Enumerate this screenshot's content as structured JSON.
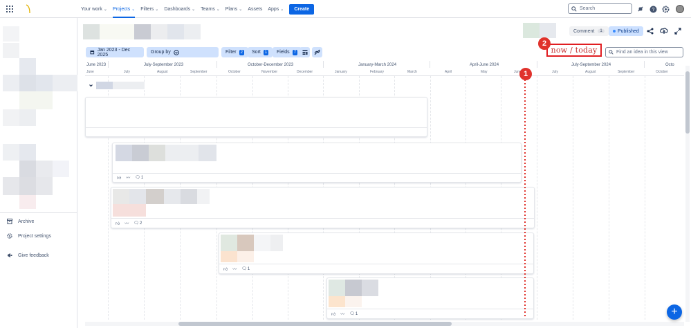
{
  "topnav": {
    "items": [
      {
        "label": "Your work"
      },
      {
        "label": "Projects"
      },
      {
        "label": "Filters"
      },
      {
        "label": "Dashboards"
      },
      {
        "label": "Teams"
      },
      {
        "label": "Plans"
      },
      {
        "label": "Assets"
      },
      {
        "label": "Apps"
      }
    ],
    "active": "Projects",
    "create_label": "Create",
    "search_placeholder": "Search",
    "icons": [
      "apps-grid-icon",
      "notifications-icon",
      "help-icon",
      "settings-icon",
      "avatar"
    ]
  },
  "sidebar": {
    "items": [
      {
        "label": "Archive",
        "icon": "archive-icon"
      },
      {
        "label": "Project settings",
        "icon": "gear-icon"
      },
      {
        "label": "Give feedback",
        "icon": "megaphone-icon"
      }
    ]
  },
  "header": {
    "comment_label": "Comment",
    "comment_count": "1",
    "published_label": "Published",
    "icons": [
      "share-icon",
      "export-icon",
      "fullscreen-icon"
    ]
  },
  "toolbar": {
    "date_range": "Jan 2023 - Dec 2025",
    "group_by_label": "Group by",
    "filter_label": "Filter",
    "filter_count": "2",
    "sort_label": "Sort",
    "sort_count": "1",
    "fields_label": "Fields",
    "fields_count": "7",
    "find_placeholder": "Find an idea in this view"
  },
  "annotation": {
    "marker1": "1",
    "marker2": "2",
    "now_today": "now / today",
    "color": "#e0322c"
  },
  "timeline": {
    "quarters": [
      "June 2023",
      "July-September 2023",
      "October-December 2023",
      "January-March 2024",
      "April-June 2024",
      "July-September 2024",
      "Octo"
    ],
    "months": [
      "June",
      "July",
      "August",
      "September",
      "October",
      "November",
      "December",
      "January",
      "February",
      "March",
      "April",
      "May",
      "June",
      "July",
      "August",
      "September",
      "October"
    ]
  },
  "cards": [
    {
      "comments": "1"
    },
    {
      "comments": "2"
    },
    {
      "comments": "1"
    },
    {
      "comments": "1"
    }
  ],
  "colors": {
    "accent": "#0c66e4",
    "toolbar_bg": "#cfe1fd",
    "published_bg": "#cce0ff"
  }
}
